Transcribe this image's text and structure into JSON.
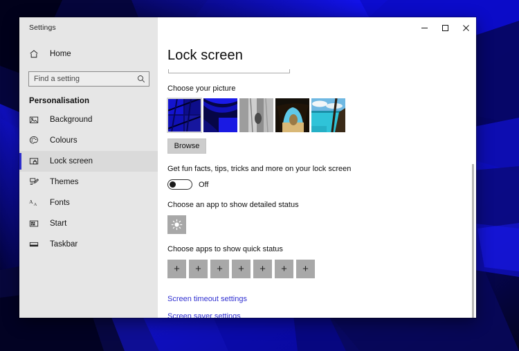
{
  "window": {
    "title": "Settings",
    "controls": [
      {
        "name": "minimize",
        "glyph": "minimize-icon"
      },
      {
        "name": "maximize",
        "glyph": "maximize-icon"
      },
      {
        "name": "close",
        "glyph": "close-icon"
      }
    ]
  },
  "sidebar": {
    "home_label": "Home",
    "home_icon": "home-icon",
    "search": {
      "placeholder": "Find a setting",
      "value": "",
      "icon": "search-icon"
    },
    "category": "Personalisation",
    "items": [
      {
        "label": "Background",
        "icon": "picture-icon",
        "selected": false
      },
      {
        "label": "Colours",
        "icon": "palette-icon",
        "selected": false
      },
      {
        "label": "Lock screen",
        "icon": "lock-screen-icon",
        "selected": true
      },
      {
        "label": "Themes",
        "icon": "themes-icon",
        "selected": false
      },
      {
        "label": "Fonts",
        "icon": "fonts-icon",
        "selected": false
      },
      {
        "label": "Start",
        "icon": "start-icon",
        "selected": false
      },
      {
        "label": "Taskbar",
        "icon": "taskbar-icon",
        "selected": false
      }
    ]
  },
  "main": {
    "page_title": "Lock screen",
    "picture_section": {
      "label": "Choose your picture",
      "thumbnails": [
        {
          "name": "blue-abstract-tiles",
          "selected": true
        },
        {
          "name": "blue-abstract-curves",
          "selected": false
        },
        {
          "name": "grayscale-rock-face",
          "selected": false
        },
        {
          "name": "beach-cave-arch",
          "selected": false
        },
        {
          "name": "turquoise-lagoon-boat",
          "selected": false
        }
      ],
      "browse_label": "Browse"
    },
    "fun_facts": {
      "label": "Get fun facts, tips, tricks and more on your lock screen",
      "state": "Off",
      "checked": false
    },
    "detailed_status": {
      "label": "Choose an app to show detailed status",
      "tile_icon": "weather-sun-icon"
    },
    "quick_status": {
      "label": "Choose apps to show quick status",
      "tile_count": 7,
      "tile_glyph": "+"
    },
    "links": [
      {
        "label": "Screen timeout settings"
      },
      {
        "label": "Screen saver settings"
      }
    ]
  },
  "colors": {
    "accent": "#2e2ecc",
    "link": "#2f2fd0",
    "sidebar_bg": "#e6e6e6",
    "tile_gray": "#a8a8a8",
    "button_gray": "#cdcdcd"
  }
}
